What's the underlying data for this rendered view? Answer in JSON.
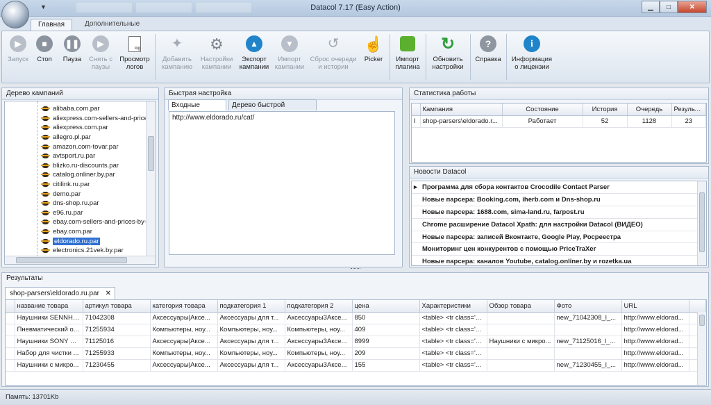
{
  "window": {
    "title": "Datacol 7.17 (Easy Action)"
  },
  "ribbon_tabs": [
    {
      "label": "Главная"
    },
    {
      "label": "Дополнительные"
    }
  ],
  "toolbar": {
    "buttons": [
      {
        "label": "Запуск",
        "enabled": false,
        "icon": "play-icon"
      },
      {
        "label": "Стоп",
        "enabled": true,
        "icon": "stop-icon"
      },
      {
        "label": "Пауза",
        "enabled": true,
        "icon": "pause-icon"
      },
      {
        "label": "Снять с паузы",
        "enabled": false,
        "icon": "resume-icon"
      },
      {
        "label": "Просмотр логов",
        "enabled": true,
        "icon": "log-file-icon"
      },
      {
        "label": "Добавить кампанию",
        "enabled": false,
        "icon": "magic-wand-icon"
      },
      {
        "label": "Настройки кампании",
        "enabled": false,
        "icon": "gear-icon"
      },
      {
        "label": "Экспорт кампании",
        "enabled": true,
        "icon": "export-icon"
      },
      {
        "label": "Импорт кампании",
        "enabled": false,
        "icon": "import-icon"
      },
      {
        "label": "Сброс очереди и истории",
        "enabled": false,
        "icon": "reset-icon"
      },
      {
        "label": "Picker",
        "enabled": true,
        "icon": "hand-pointer-icon"
      },
      {
        "label": "Импорт плагина",
        "enabled": true,
        "icon": "puzzle-icon"
      },
      {
        "label": "Обновить настройки",
        "enabled": true,
        "icon": "refresh-icon"
      },
      {
        "label": "Справка",
        "enabled": true,
        "icon": "help-icon"
      },
      {
        "label": "Информация о лицензии",
        "enabled": true,
        "icon": "info-icon"
      }
    ]
  },
  "campaign_tree": {
    "title": "Дерево кампаний",
    "items": [
      "alibaba.com.par",
      "aliexpress.com-sellers-and-price",
      "aliexpress.com.par",
      "allegro.pl.par",
      "amazon.com-tovar.par",
      "avtsport.ru.par",
      "blizko.ru-discounts.par",
      "catalog.onliner.by.par",
      "citilink.ru.par",
      "demo.par",
      "dns-shop.ru.par",
      "e96.ru.par",
      "ebay.com-sellers-and-prices-by-",
      "ebay.com.par",
      "eldorado.ru.par",
      "electronics.21vek.by.par"
    ],
    "selected_index": 14
  },
  "quick_setup": {
    "title": "Быстрая настройка",
    "tabs": [
      "Входные данные",
      "Дерево быстрой настройки"
    ],
    "input_text": "http://www.eldorado.ru/cat/"
  },
  "stats": {
    "title": "Статистика работы",
    "columns": [
      "Кампания",
      "Состояние",
      "История",
      "Очередь",
      "Результаты"
    ],
    "rows": [
      [
        "shop-parsers\\eldorado.r...",
        "Работает",
        "52",
        "1128",
        "23"
      ]
    ]
  },
  "news": {
    "title": "Новости Datacol",
    "items": [
      "Программа для  сбора контактов Crocodile Contact Parser",
      "Новые парсера: Booking.com, iherb.com и Dns-shop.ru",
      "Новые парсера: 1688.com, sima-land.ru, farpost.ru",
      "Chrome расширение Datacol Xpath: для настройки Datacol (ВИДЕО)",
      "Новые парсера: записей Вконтакте, Google Play, Росреестра",
      "Мониторинг цен конкурентов с помощью PriceTraXer",
      "Новые парсера: каналов Youtube, catalog.onliner.by и rozetka.ua"
    ]
  },
  "results": {
    "title": "Результаты",
    "tab": "shop-parsers\\eldorado.ru.par",
    "columns": [
      "название товара",
      "артикул товара",
      "категория товара",
      "подкатегория 1",
      "подкатегория 2",
      "цена",
      "Характеристики",
      "Обзор товара",
      "Фото",
      "URL"
    ],
    "rows": [
      [
        "Наушники SENNHE...",
        "71042308",
        "Аксессуары|Аксе...",
        "Аксессуары для т...",
        "Аксессуары3Аксе...",
        "850",
        "<table> <tr class='...",
        "",
        "new_71042308_l_...",
        "http://www.eldorad..."
      ],
      [
        "Пневматический о...",
        "71255934",
        "Компьютеры, ноу...",
        "Компьютеры, ноу...",
        "Компьютеры, ноу...",
        "409",
        "<table> <tr class='...",
        "",
        "",
        "http://www.eldorad..."
      ],
      [
        "Наушники SONY M...",
        "71125016",
        "Аксессуары|Аксе...",
        "Аксессуары для т...",
        "Аксессуары3Аксе...",
        "8999",
        "<table> <tr class='...",
        "Наушники с микро...",
        "new_71125016_l_...",
        "http://www.eldorad..."
      ],
      [
        "Набор для чистки ...",
        "71255933",
        "Компьютеры, ноу...",
        "Компьютеры, ноу...",
        "Компьютеры, ноу...",
        "209",
        "<table> <tr class='...",
        "",
        "",
        "http://www.eldorad..."
      ],
      [
        "Наушники с микро...",
        "71230455",
        "Аксессуары|Аксе...",
        "Аксессуары для т...",
        "Аксессуары3Аксе...",
        "155",
        "<table> <tr class='...",
        "",
        "new_71230455_l_...",
        "http://www.eldorad..."
      ]
    ]
  },
  "status": {
    "memory": "Память: 13701Kb"
  }
}
